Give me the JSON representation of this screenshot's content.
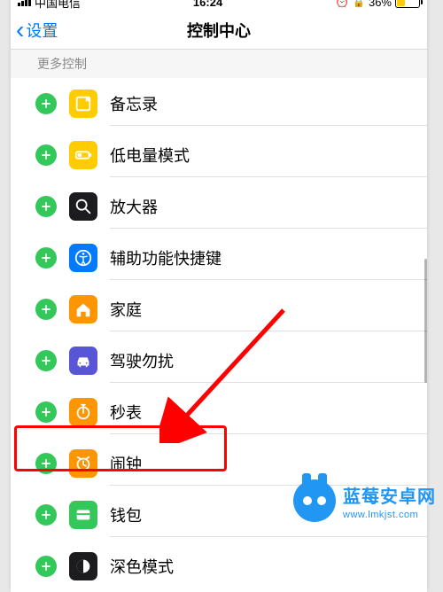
{
  "status": {
    "carrier": "中国电信",
    "time": "16:24",
    "battery_pct": "36%"
  },
  "nav": {
    "back_label": "设置",
    "title": "控制中心"
  },
  "section_header": "更多控制",
  "items": [
    {
      "id": "notes",
      "label": "备忘录"
    },
    {
      "id": "lowpower",
      "label": "低电量模式"
    },
    {
      "id": "magnifier",
      "label": "放大器"
    },
    {
      "id": "accessibility",
      "label": "辅助功能快捷键"
    },
    {
      "id": "home",
      "label": "家庭"
    },
    {
      "id": "dnd",
      "label": "驾驶勿扰"
    },
    {
      "id": "stopwatch",
      "label": "秒表"
    },
    {
      "id": "alarm",
      "label": "闹钟"
    },
    {
      "id": "wallet",
      "label": "钱包"
    },
    {
      "id": "dark",
      "label": "深色模式"
    }
  ],
  "watermark": {
    "line1": "蓝莓安卓网",
    "line2": "www.lmkjst.com"
  }
}
